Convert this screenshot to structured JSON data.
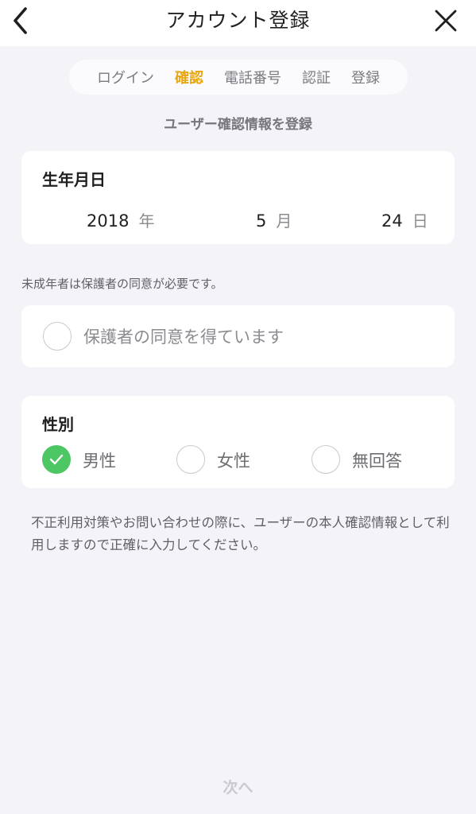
{
  "header": {
    "title": "アカウント登録",
    "back_icon": "chevron-left-icon",
    "close_icon": "close-icon"
  },
  "steps": [
    {
      "label": "ログイン",
      "active": false
    },
    {
      "label": "確認",
      "active": true
    },
    {
      "label": "電話番号",
      "active": false
    },
    {
      "label": "認証",
      "active": false
    },
    {
      "label": "登録",
      "active": false
    }
  ],
  "subtitle": "ユーザー確認情報を登録",
  "birthdate": {
    "label": "生年月日",
    "year": "2018",
    "year_unit": "年",
    "month": "5",
    "month_unit": "月",
    "day": "24",
    "day_unit": "日"
  },
  "minor_note": "未成年者は保護者の同意が必要です。",
  "consent": {
    "label": "保護者の同意を得ています",
    "checked": false
  },
  "gender": {
    "label": "性別",
    "options": [
      {
        "label": "男性",
        "checked": true
      },
      {
        "label": "女性",
        "checked": false
      },
      {
        "label": "無回答",
        "checked": false
      }
    ]
  },
  "info_note": "不正利用対策やお問い合わせの際に、ユーザーの本人確認情報として利用しますので正確に入力してください。",
  "next_label": "次へ",
  "colors": {
    "accent": "#e8a711",
    "check_green": "#4cc764",
    "background": "#f4f3f8",
    "disabled_text": "#c9c9ce"
  }
}
